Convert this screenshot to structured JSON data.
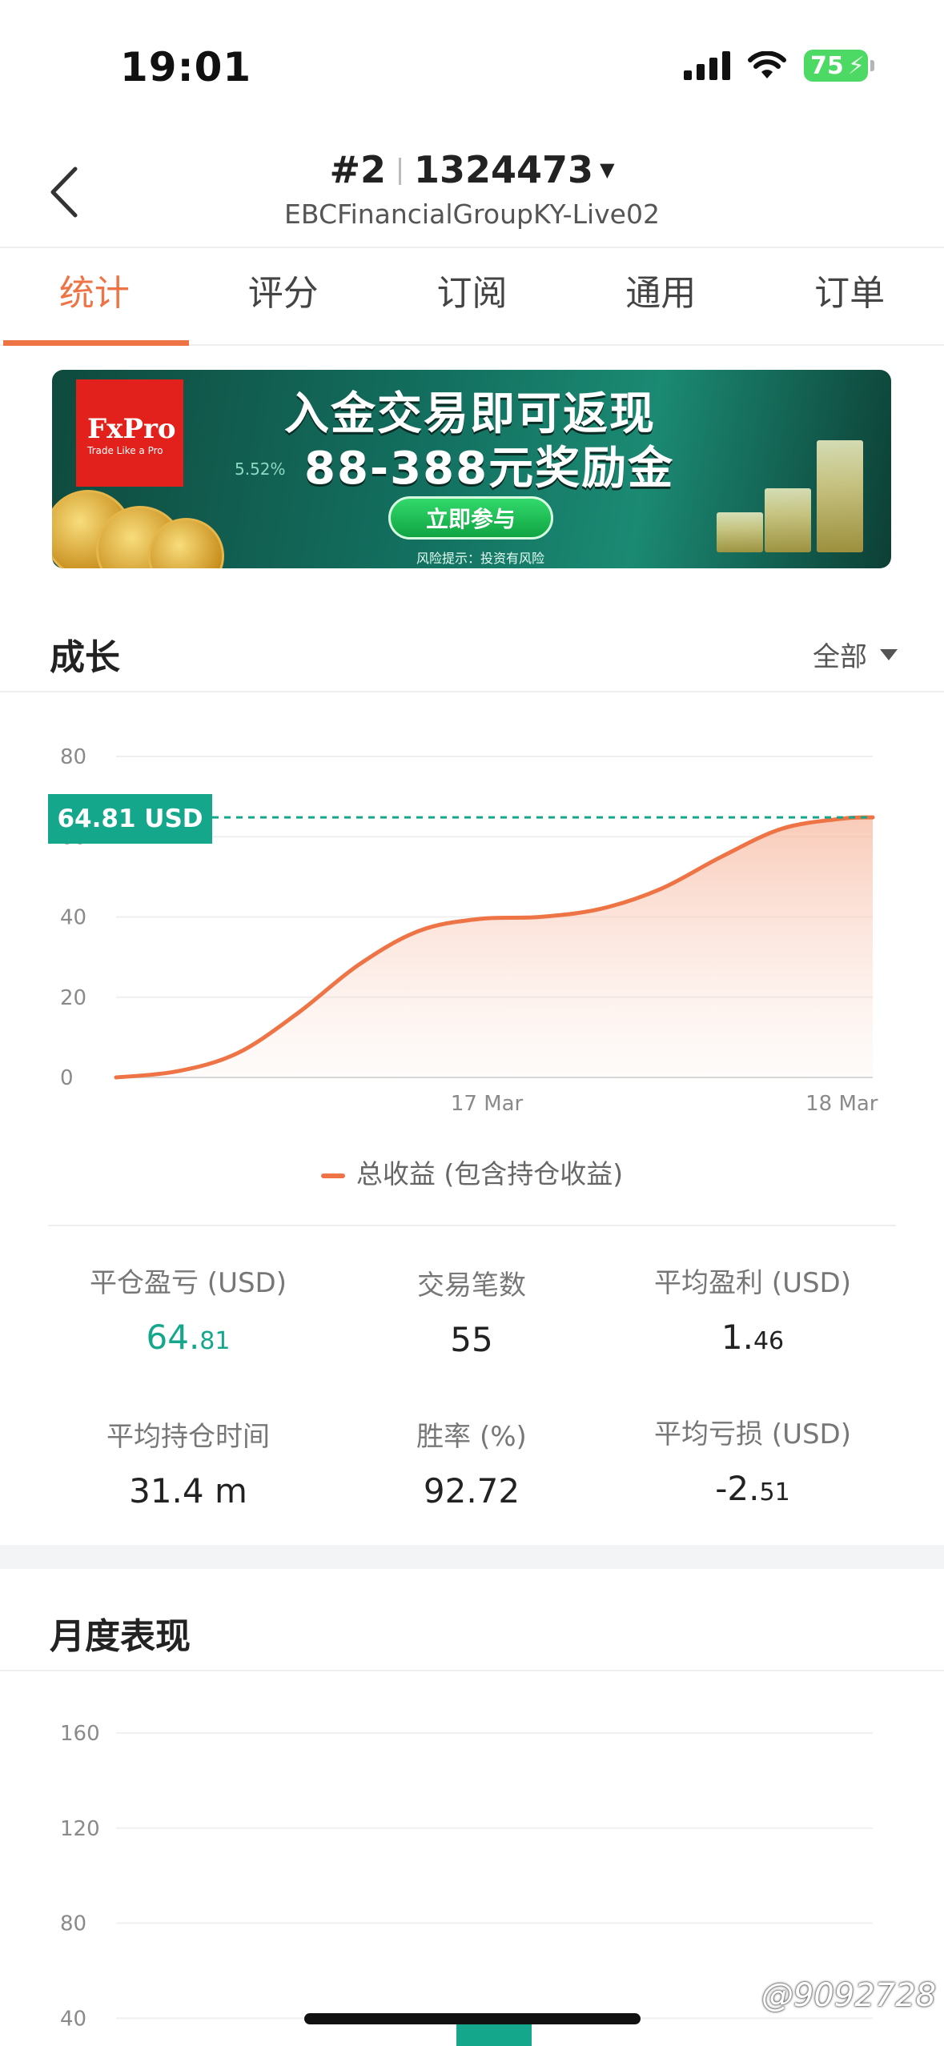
{
  "status_bar": {
    "time": "19:01",
    "battery": "75"
  },
  "header": {
    "rank": "#2",
    "account": "1324473",
    "broker": "EBCFinancialGroupKY-Live02"
  },
  "tabs": [
    {
      "label": "统计",
      "active": true
    },
    {
      "label": "评分",
      "active": false
    },
    {
      "label": "订阅",
      "active": false
    },
    {
      "label": "通用",
      "active": false
    },
    {
      "label": "订单",
      "active": false
    }
  ],
  "banner": {
    "brand": "FxPro",
    "brand_tagline": "Trade Like a Pro",
    "percent_text": "5.52%",
    "headline_line1": "入金交易即可返现",
    "headline_line2": "88-388元奖励金",
    "cta": "立即参与",
    "risk_note": "风险提示：投资有风险"
  },
  "growth": {
    "title": "成长",
    "range_label": "全部",
    "current_badge": "64.81 USD",
    "legend": "总收益 (包含持仓收益)"
  },
  "chart_data": [
    {
      "type": "area",
      "title": "成长",
      "x_tick_labels": [
        "17 Mar",
        "18 Mar"
      ],
      "y_tick_labels": [
        "0",
        "20",
        "40",
        "60",
        "80"
      ],
      "ylim": [
        0,
        80
      ],
      "series": [
        {
          "name": "总收益 (包含持仓收益)",
          "color": "#ef7445",
          "x": [
            0,
            0.08,
            0.16,
            0.24,
            0.32,
            0.4,
            0.48,
            0.56,
            0.64,
            0.72,
            0.8,
            0.88,
            0.96,
            1.0
          ],
          "y": [
            0,
            1.5,
            6,
            16,
            28,
            36.5,
            39.5,
            40,
            42,
            47,
            55,
            62,
            64.5,
            64.81
          ]
        }
      ],
      "reference_line": {
        "value": 64.81,
        "color": "#14a78c",
        "style": "dashed"
      },
      "grid": true
    },
    {
      "type": "bar",
      "title": "月度表现",
      "y_tick_labels": [
        "40",
        "80",
        "120",
        "160"
      ],
      "ylim": [
        0,
        160
      ],
      "grid": true,
      "color": "#14a78c"
    }
  ],
  "stats": [
    {
      "label": "平仓盈亏 (USD)",
      "int": "64.",
      "dec": "81",
      "green": true
    },
    {
      "label": "交易笔数",
      "int": "55",
      "dec": "",
      "green": false
    },
    {
      "label": "平均盈利 (USD)",
      "int": "1.",
      "dec": "46",
      "green": false
    },
    {
      "label": "平均持仓时间",
      "int": "31.4 m",
      "dec": "",
      "green": false
    },
    {
      "label": "胜率 (%)",
      "int": "92.72",
      "dec": "",
      "green": false
    },
    {
      "label": "平均亏损 (USD)",
      "int": "-2.",
      "dec": "51",
      "green": false
    }
  ],
  "monthly": {
    "title": "月度表现"
  },
  "watermark": "@9092728"
}
